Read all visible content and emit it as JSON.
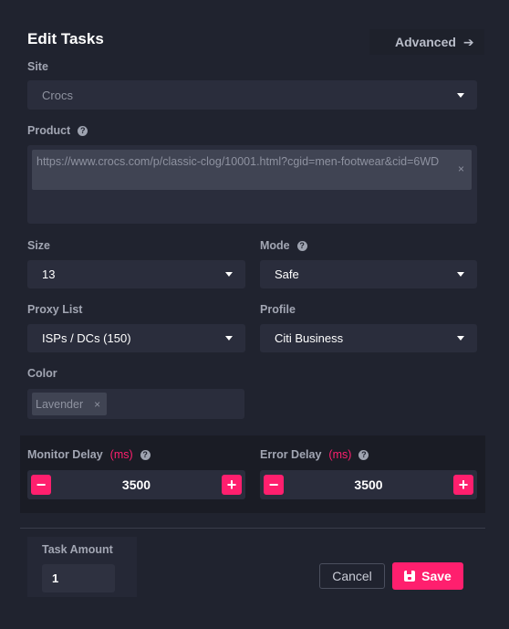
{
  "header": {
    "title": "Edit Tasks",
    "advanced_label": "Advanced",
    "advanced_icon": "arrow-right-icon"
  },
  "site": {
    "label": "Site",
    "value": "Crocs"
  },
  "product": {
    "label": "Product",
    "help_icon": "help-icon",
    "chip_value": "https://www.crocs.com/p/classic-clog/10001.html?cgid=men-footwear&cid=6WD"
  },
  "size": {
    "label": "Size",
    "value": "13"
  },
  "mode": {
    "label": "Mode",
    "value": "Safe"
  },
  "proxy": {
    "label": "Proxy List",
    "value": "ISPs / DCs (150)"
  },
  "profile": {
    "label": "Profile",
    "value": "Citi Business"
  },
  "color": {
    "label": "Color",
    "chip_value": "Lavender"
  },
  "monitor_delay": {
    "label": "Monitor Delay",
    "unit": "(ms)",
    "value": "3500"
  },
  "error_delay": {
    "label": "Error Delay",
    "unit": "(ms)",
    "value": "3500"
  },
  "task_amount": {
    "label": "Task Amount",
    "value": "1"
  },
  "actions": {
    "cancel_label": "Cancel",
    "save_label": "Save"
  },
  "colors": {
    "accent": "#ff1f6e",
    "background": "#20232f",
    "field": "#2a2d3c"
  }
}
